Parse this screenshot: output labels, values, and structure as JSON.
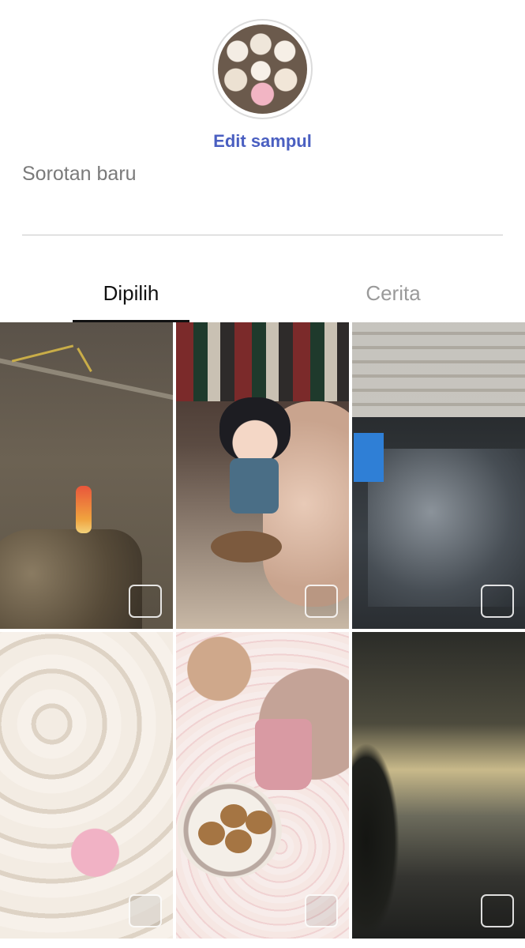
{
  "cover": {
    "edit_label": "Edit sampul"
  },
  "title_field": {
    "placeholder": "Sorotan baru",
    "value": ""
  },
  "tabs": [
    {
      "label": "Dipilih",
      "selected": true
    },
    {
      "label": "Cerita",
      "selected": false
    }
  ],
  "grid": {
    "items": [
      {
        "name": "photo-street-popsicle",
        "checked": false
      },
      {
        "name": "photo-figurine",
        "checked": false
      },
      {
        "name": "photo-kitchen",
        "checked": false
      },
      {
        "name": "photo-mugs",
        "checked": false
      },
      {
        "name": "photo-coffee-cookies",
        "checked": false
      },
      {
        "name": "photo-sky",
        "checked": false
      }
    ]
  },
  "colors": {
    "accent": "#4a5fc1",
    "tab_inactive": "#9a9a9a",
    "divider": "#c7c7c7"
  }
}
